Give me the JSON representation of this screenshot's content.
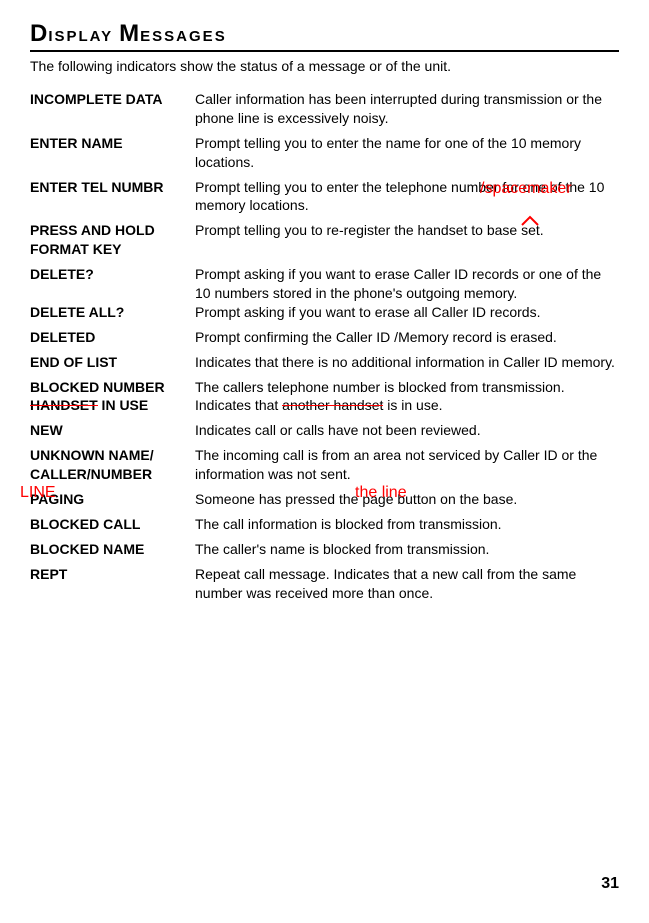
{
  "title": {
    "word1_first": "D",
    "word1_rest": "ISPLAY",
    "word2_first": "M",
    "word2_rest": "ESSAGES"
  },
  "intro": "The following indicators show the status of a message or of the unit.",
  "entries": [
    {
      "term": "INCOMPLETE DATA",
      "desc": "Caller information has been interrupted during transmission or the phone line is excessively noisy."
    },
    {
      "term": "ENTER NAME",
      "desc": "Prompt telling you to enter the name for one of the 10 memory locations."
    },
    {
      "term": "ENTER TEL NUMBR",
      "desc": "Prompt telling you to enter the telephone number for one of the 10 memory locations."
    },
    {
      "term": "PRESS AND HOLD FORMAT KEY",
      "desc": "Prompt telling you to re-register the handset to base set."
    },
    {
      "term": "DELETE?",
      "desc": "Prompt asking if you want to erase Caller ID records or one of the 10 numbers stored in the phone's outgoing memory."
    },
    {
      "term": "DELETE ALL?",
      "desc": "Prompt asking if you want to erase all Caller ID records."
    },
    {
      "term": "DELETED",
      "desc": "Prompt confirming the Caller ID /Memory record is erased."
    },
    {
      "term": "END OF LIST",
      "desc": "Indicates that there is no additional information in Caller ID memory."
    },
    {
      "term": "BLOCKED NUMBER",
      "desc": "The callers telephone number is blocked from transmission."
    },
    {
      "term_strike": "HANDSET",
      "term_plain": " IN USE",
      "desc_pre": "Indicates that ",
      "desc_strike": "another handset",
      "desc_post": " is in use."
    },
    {
      "term": "NEW",
      "desc": "Indicates call or calls have not been reviewed."
    },
    {
      "term": "UNKNOWN NAME/ CALLER/NUMBER",
      "desc": "The incoming call is from an area not serviced by Caller ID or the information was not sent."
    },
    {
      "term": "PAGING",
      "desc": "Someone has pressed the page button on the base."
    },
    {
      "term": "BLOCKED CALL",
      "desc": "The call information is blocked from transmission."
    },
    {
      "term": "BLOCKED NAME",
      "desc": "The caller's name is blocked from transmission."
    },
    {
      "term": "REPT",
      "desc": "Repeat call message. Indicates that a new call from the same number was received more than once."
    }
  ],
  "annotations": {
    "spacemaker": "/spacemaker",
    "caret": "^",
    "line": "LINE",
    "theline": "the line"
  },
  "page_num": "31"
}
